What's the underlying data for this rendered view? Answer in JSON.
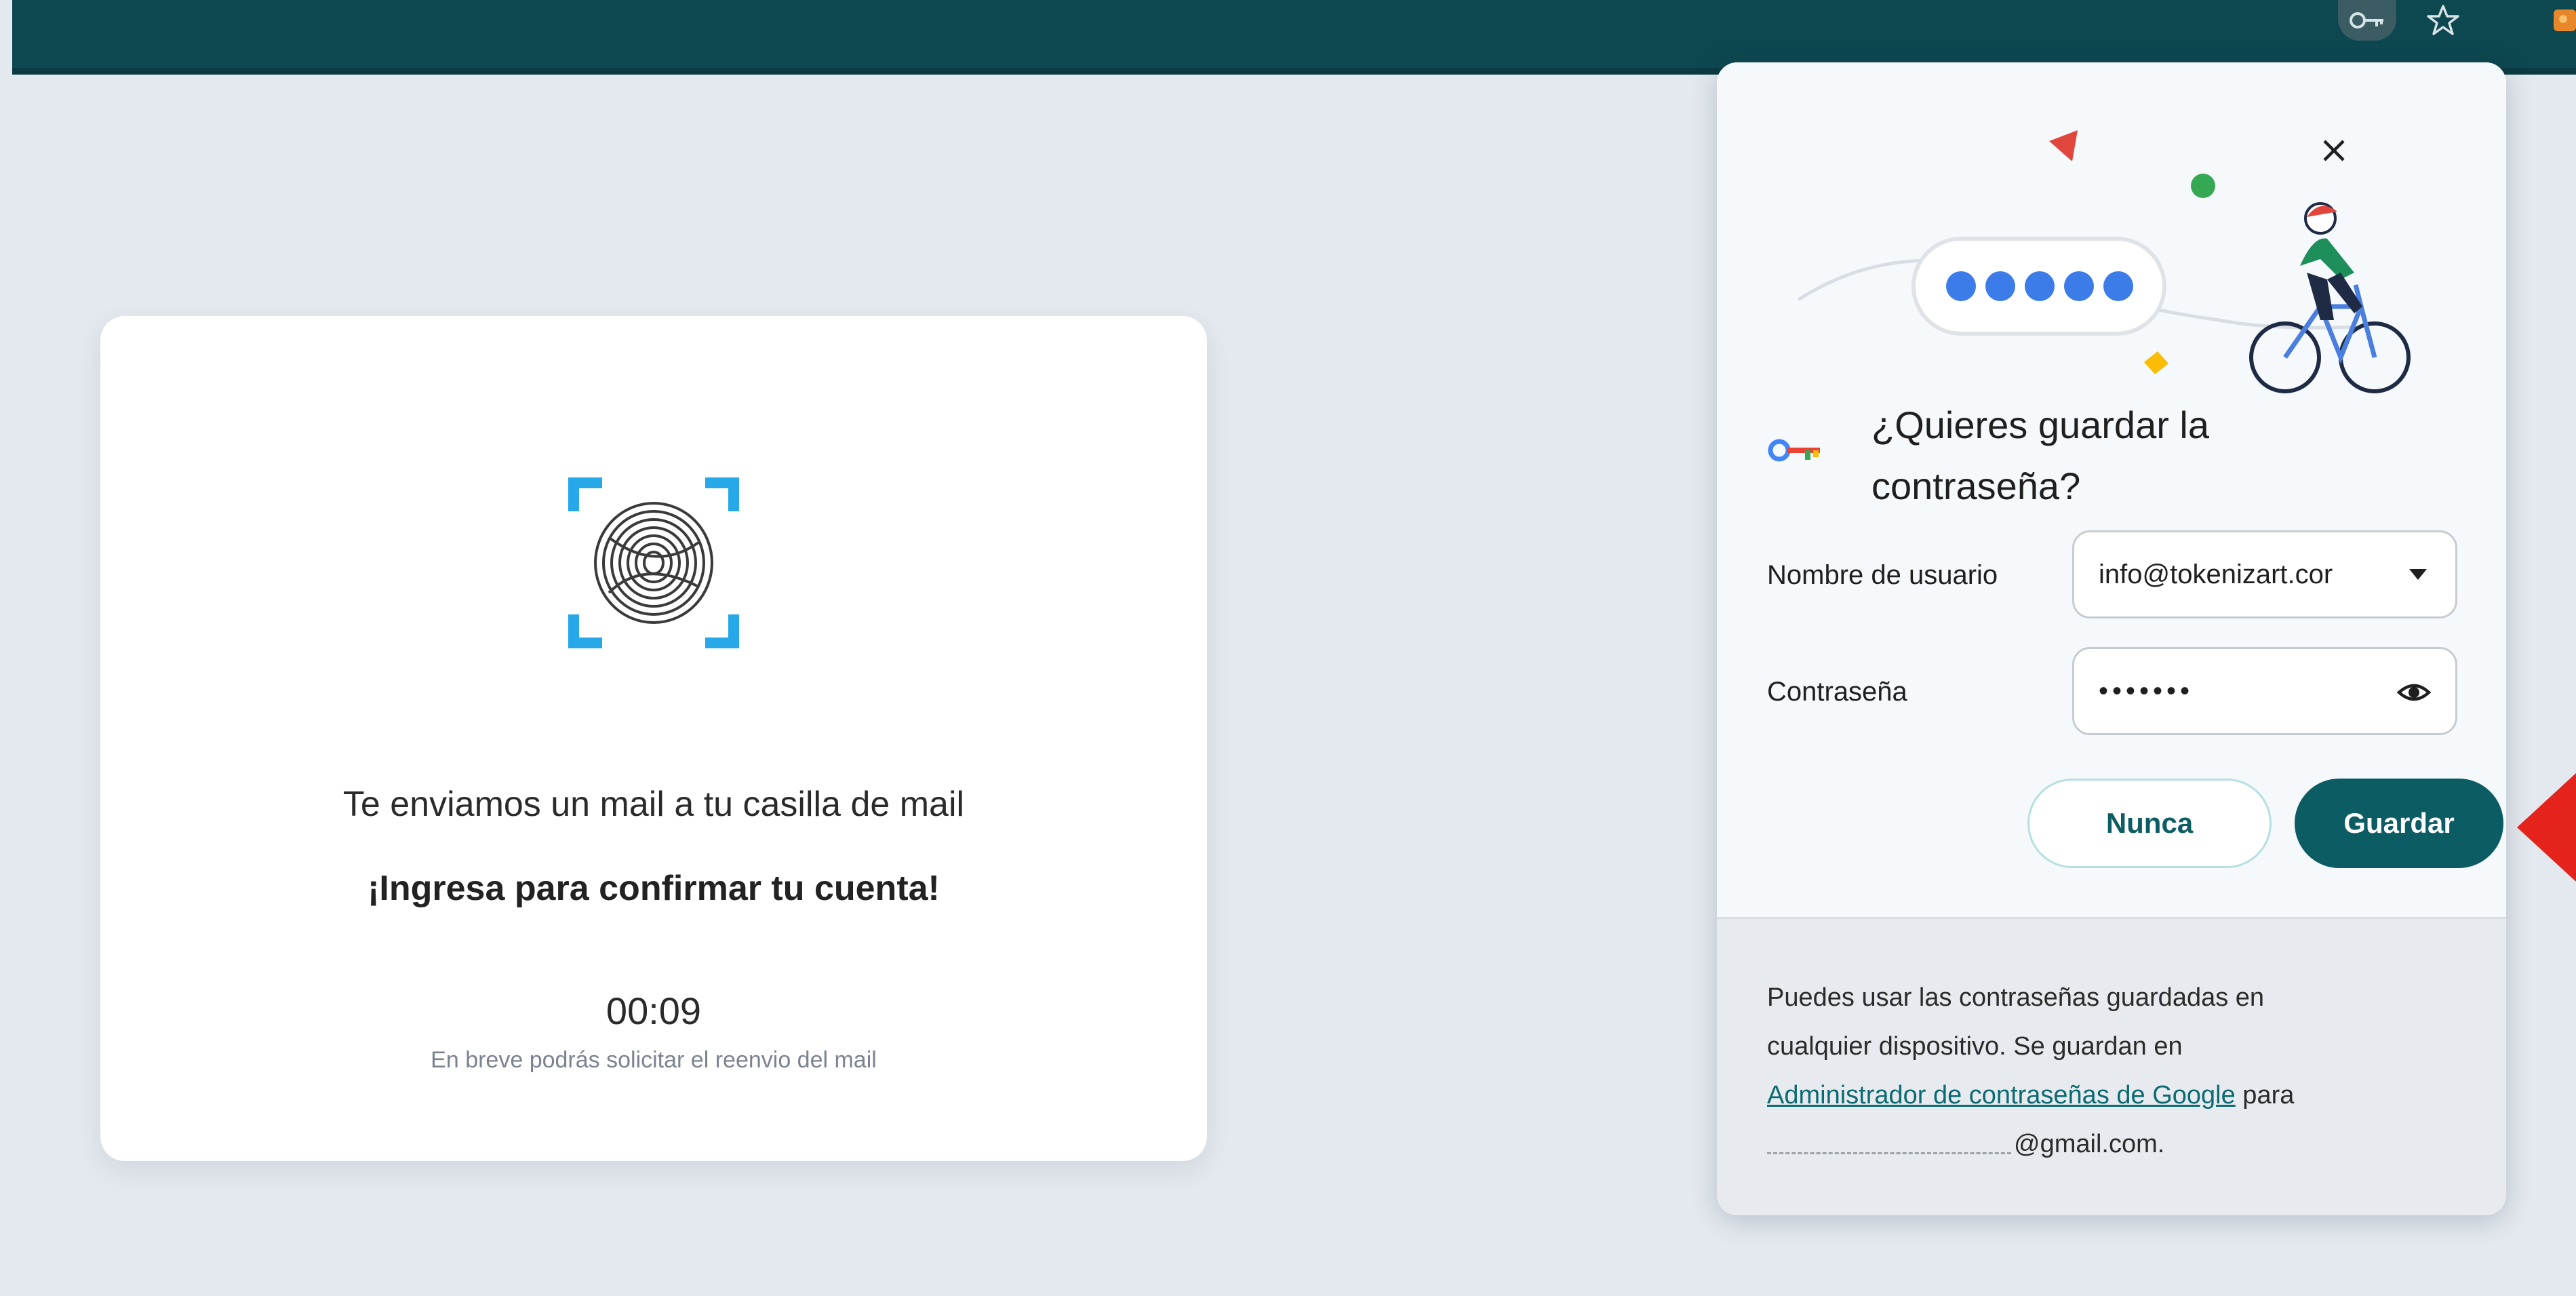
{
  "colors": {
    "toolbar": "#0d4750",
    "primary": "#0b5c63",
    "page_bg": "#e4e9ef",
    "arrow": "#e4241c",
    "timer_hint": "#7b8290"
  },
  "toolbar": {
    "icons": [
      "password-key-icon",
      "star-icon",
      "extension-icon"
    ]
  },
  "card": {
    "icon": "fingerprint-scan-icon",
    "message": "Te enviamos un mail a tu casilla de mail",
    "cta": "¡Ingresa para confirmar tu cuenta!",
    "timer": "00:09",
    "hint": "En breve podrás solicitar el reenvio del mail"
  },
  "bubble": {
    "title": "¿Quieres guardar la contraseña?",
    "username_label": "Nombre de usuario",
    "username_value": "info@tokenizart.cor",
    "password_label": "Contraseña",
    "password_mask": "•••••••",
    "never_label": "Nunca",
    "save_label": "Guardar",
    "footer_line1": "Puedes usar las contraseñas guardadas en",
    "footer_line2": "cualquier dispositivo. Se guardan en",
    "footer_link": "Administrador de contraseñas de Google",
    "footer_para": " para",
    "footer_email_suffix": "@gmail.com."
  }
}
